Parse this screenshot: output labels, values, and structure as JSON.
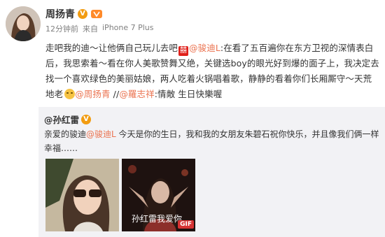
{
  "user": {
    "name": "周扬青",
    "verified_badge": "V"
  },
  "meta": {
    "time": "12分钟前",
    "source_prefix": "来自",
    "source": "iPhone 7 Plus"
  },
  "post": {
    "text1": "走吧我的迪～让他俩自己玩儿去吧",
    "mention1": "@骏迪L",
    "text2": ":在看了五百遍你在东方卫视的深情表白后，我思索着～看在你人美歌赞舞又绝，关键选boy的眼光好到爆的面子上，我决定去找一个喜欢绿色的美丽姑娘，两人吃着火锅唱着歌，静静的看着你们长厢厮守～天荒地老",
    "mention2": "@周扬青",
    "mention3": "@羅志祥",
    "text3": ":情敵 生日快樂喔"
  },
  "repost": {
    "author": "@孙红雷",
    "text_prefix": "亲爱的骏迪",
    "mention": "@骏迪L",
    "text_suffix": " 今天是你的生日，我和我的女朋友朱碧石祝你快乐，并且像我们俩一样幸福……",
    "gif_label": "GIF",
    "gif_caption": "孙红雷我爱你"
  },
  "colors": {
    "link": "#eb7350",
    "badge": "#f29c11",
    "repost_bg": "#f2f2f5"
  }
}
